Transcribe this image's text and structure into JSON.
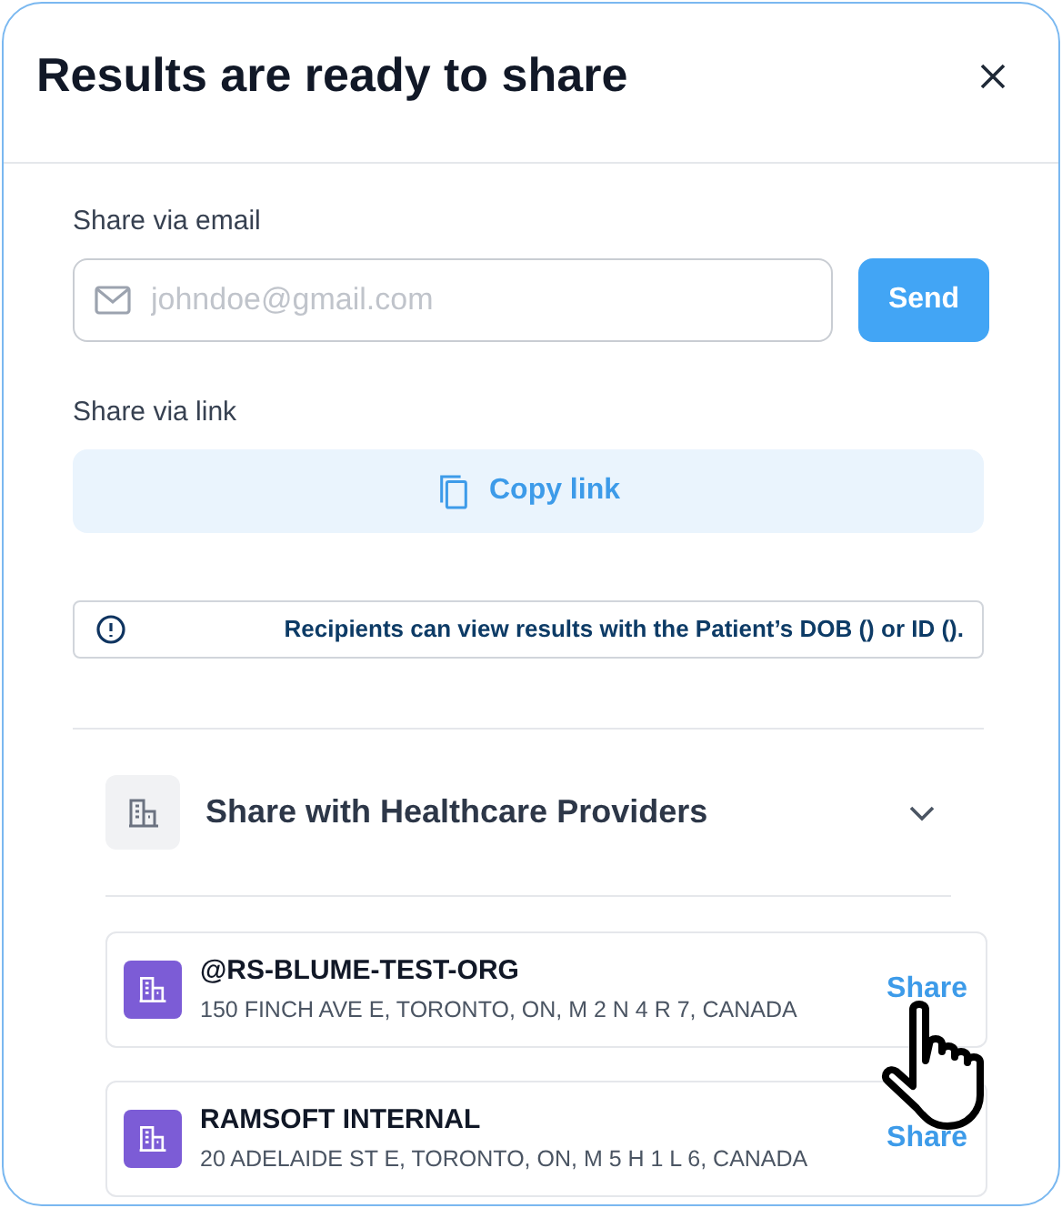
{
  "dialog": {
    "title": "Results are ready to share"
  },
  "email": {
    "label": "Share via email",
    "placeholder": "johndoe@gmail.com",
    "button": "Send"
  },
  "link": {
    "label": "Share via link",
    "button": "Copy link"
  },
  "notice": "Recipients can view results with the Patient’s DOB () or ID ().",
  "providers": {
    "title": "Share with Healthcare Providers",
    "expanded": true,
    "items": [
      {
        "name": "@RS-BLUME-TEST-ORG",
        "address": "150 FINCH AVE E, TORONTO, ON, M 2 N 4 R 7, CANADA",
        "action": "Share"
      },
      {
        "name": "RAMSOFT INTERNAL",
        "address": "20 ADELAIDE ST E, TORONTO, ON, M 5 H 1 L 6, CANADA",
        "action": "Share"
      }
    ]
  }
}
